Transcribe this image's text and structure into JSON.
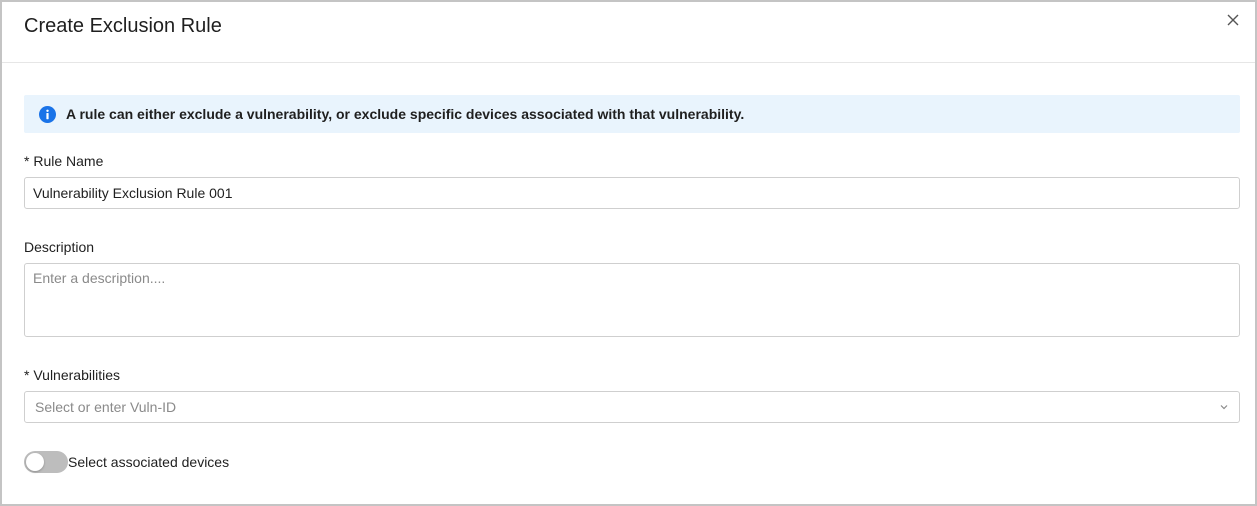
{
  "dialog": {
    "title": "Create Exclusion Rule",
    "close_icon": "close-icon"
  },
  "info_banner": {
    "icon": "info-icon",
    "text": "A rule can either exclude a vulnerability, or exclude specific devices associated with that vulnerability.",
    "background_color": "#e9f4fd",
    "icon_color": "#1a73e8"
  },
  "form": {
    "rule_name": {
      "label": "* Rule Name",
      "value": "Vulnerability Exclusion Rule 001"
    },
    "description": {
      "label": "Description",
      "value": "",
      "placeholder": "Enter a description...."
    },
    "vulnerabilities": {
      "label": "* Vulnerabilities",
      "placeholder": "Select or enter Vuln-ID",
      "icon": "chevron-down-icon"
    },
    "associated_devices": {
      "label": "Select associated devices",
      "enabled": false
    }
  }
}
